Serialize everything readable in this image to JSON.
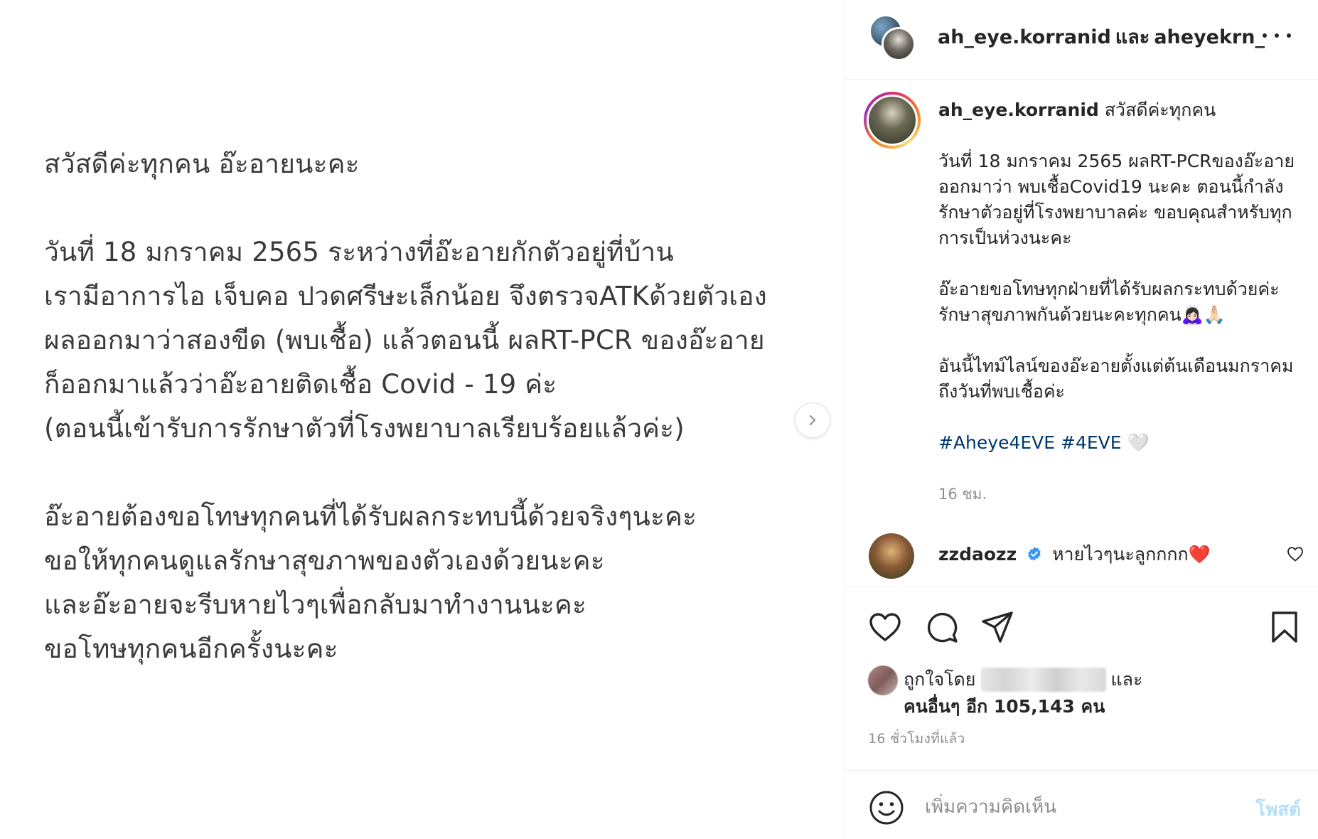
{
  "media": {
    "paragraphs": [
      [
        "สวัสดีค่ะทุกคน อ๊ะอายนะคะ"
      ],
      [
        "วันที่ 18 มกราคม 2565 ระหว่างที่อ๊ะอายกักตัวอยู่ที่บ้าน",
        "เรามีอาการไอ เจ็บคอ ปวดศรีษะเล็กน้อย จึงตรวจATKด้วยตัวเอง",
        "ผลออกมาว่าสองขีด (พบเชื้อ) แล้วตอนนี้ ผลRT-PCR ของอ๊ะอาย",
        "ก็ออกมาแล้วว่าอ๊ะอายติดเชื้อ Covid - 19 ค่ะ",
        "(ตอนนี้เข้ารับการรักษาตัวที่โรงพยาบาลเรียบร้อยแล้วค่ะ)"
      ],
      [
        "อ๊ะอายต้องขอโทษทุกคนที่ได้รับผลกระทบนี้ด้วยจริงๆนะคะ",
        "ขอให้ทุกคนดูแลรักษาสุขภาพของตัวเองด้วยนะคะ",
        "และอ๊ะอายจะรีบหายไวๆเพื่อกลับมาทำงานนะคะ",
        "ขอโทษทุกคนอีกครั้งนะคะ"
      ]
    ]
  },
  "header": {
    "user1": "ah_eye.korranid",
    "conjunction": "และ",
    "user2": "aheyekrn_"
  },
  "caption": {
    "username": "ah_eye.korranid",
    "first_line": "สวัสดีค่ะทุกคน",
    "para1": "วันที่ 18 มกราคม 2565 ผลRT-PCRของอ๊ะอาย ออกมาว่า พบเชื้อCovid19 นะคะ ตอนนี้กำลังรักษาตัวอยู่ที่โรงพยาบาลค่ะ ขอบคุณสำหรับทุกการเป็นห่วงนะคะ",
    "para2": "อ๊ะอายขอโทษทุกฝ่ายที่ได้รับผลกระทบด้วยค่ะ รักษาสุขภาพกันด้วยนะคะทุกคน🙇🏻‍♀️🙏🏻",
    "para3": "อันนี้ไทม์ไลน์ของอ๊ะอายตั้งแต่ต้นเดือนมกราคมถึงวันที่พบเชื้อค่ะ",
    "hashtags": "#Aheye4EVE #4EVE",
    "hashtag_emoji": "🤍",
    "time": "16 ชม."
  },
  "comment": {
    "username": "zzdaozz",
    "text": "หายไวๆนะลูกกกก❤️"
  },
  "likes": {
    "prefix": "ถูกใจโดย",
    "suffix": "และ",
    "others": "คนอื่นๆ อีก 105,143 คน"
  },
  "post_time": "16 ชั่วโมงที่แล้ว",
  "comment_box": {
    "placeholder": "เพิ่มความคิดเห็น",
    "post_label": "โพสต์"
  },
  "colors": {
    "hashtag": "#00376b",
    "verified": "#3897f0",
    "post_disabled": "#b2dffc",
    "secondary_text": "#8e8e8e"
  }
}
